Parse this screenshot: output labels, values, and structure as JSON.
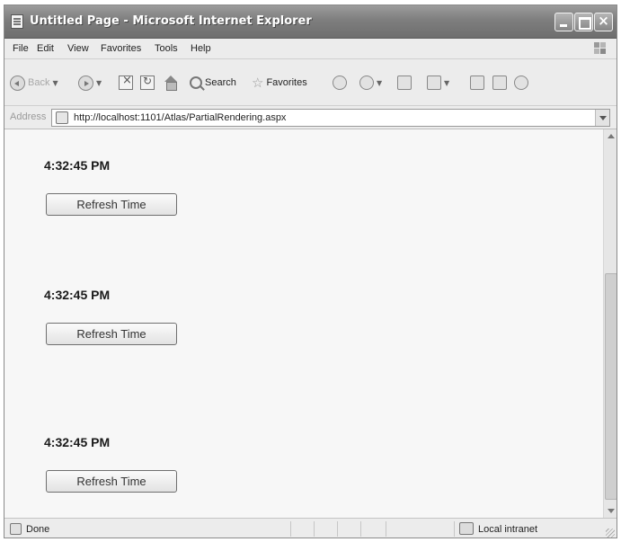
{
  "window": {
    "title": "Untitled Page - Microsoft Internet Explorer"
  },
  "menu": [
    "File",
    "Edit",
    "View",
    "Favorites",
    "Tools",
    "Help"
  ],
  "toolbar": {
    "back_label": "Back",
    "search_label": "Search",
    "favorites_label": "Favorites"
  },
  "address": {
    "label": "Address",
    "url": "http://localhost:1101/Atlas/PartialRendering.aspx"
  },
  "content": {
    "sections": [
      {
        "time": "4:32:45 PM",
        "button": "Refresh Time"
      },
      {
        "time": "4:32:45 PM",
        "button": "Refresh Time"
      },
      {
        "time": "4:32:45 PM",
        "button": "Refresh Time"
      }
    ]
  },
  "status": {
    "text": "Done",
    "zone": "Local intranet"
  }
}
